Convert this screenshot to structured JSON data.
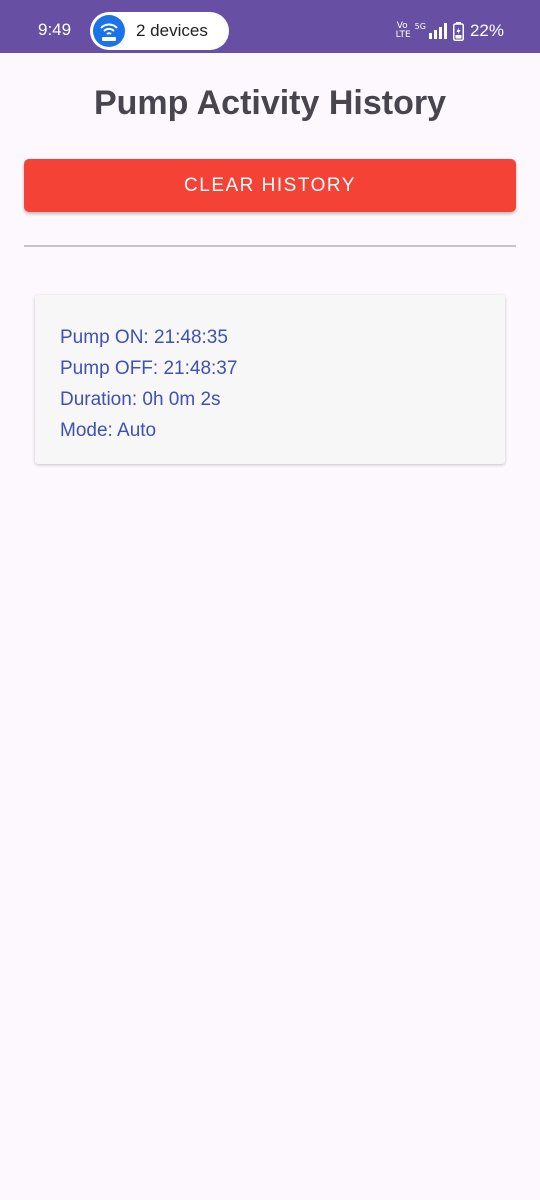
{
  "status_bar": {
    "time": "9:49",
    "hotspot_label": "2 devices",
    "volte": "Vo\nLTE",
    "network": "5G",
    "battery": "22%"
  },
  "page": {
    "title": "Pump Activity History",
    "clear_button_label": "CLEAR HISTORY"
  },
  "history": [
    {
      "on": "Pump ON: 21:48:35",
      "off": "Pump OFF: 21:48:37",
      "duration": "Duration: 0h 0m 2s",
      "mode": "Mode: Auto"
    }
  ],
  "colors": {
    "status_bar": "#6750a4",
    "clear_button": "#f44336",
    "history_text": "#3f51b5"
  }
}
